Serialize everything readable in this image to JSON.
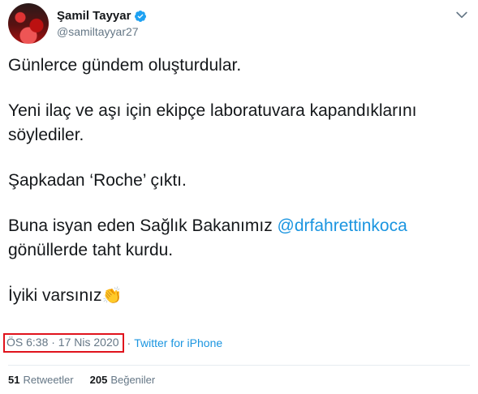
{
  "author": {
    "display_name": "Şamil Tayyar",
    "handle": "@samiltayyar27",
    "verified": true
  },
  "tweet": {
    "lines": [
      "Günlerce gündem oluşturdular.",
      "Yeni ilaç ve aşı için ekipçe laboratuvara kapandıklarını",
      "söylediler.",
      "Şapkadan ‘Roche’ çıktı.",
      "Buna isyan eden Sağlık Bakanımız ",
      "@drfahrettinkoca",
      " gönüllerde taht kurdu.",
      "İyiki varsınız",
      "👏"
    ]
  },
  "meta": {
    "timestamp": "ÖS 6:38 · 17 Nis 2020",
    "separator": "·",
    "source": "Twitter for iPhone"
  },
  "stats": {
    "retweets_count": "51",
    "retweets_label": "Retweetler",
    "likes_count": "205",
    "likes_label": "Beğeniler"
  },
  "colors": {
    "accent": "#1b95e0",
    "muted": "#657786",
    "highlight_box": "#e0131c",
    "verified_badge": "#1da1f2"
  },
  "icons": {
    "verified": "verified-badge-icon",
    "menu": "chevron-down-icon",
    "emoji": "clapping-hands-emoji"
  }
}
